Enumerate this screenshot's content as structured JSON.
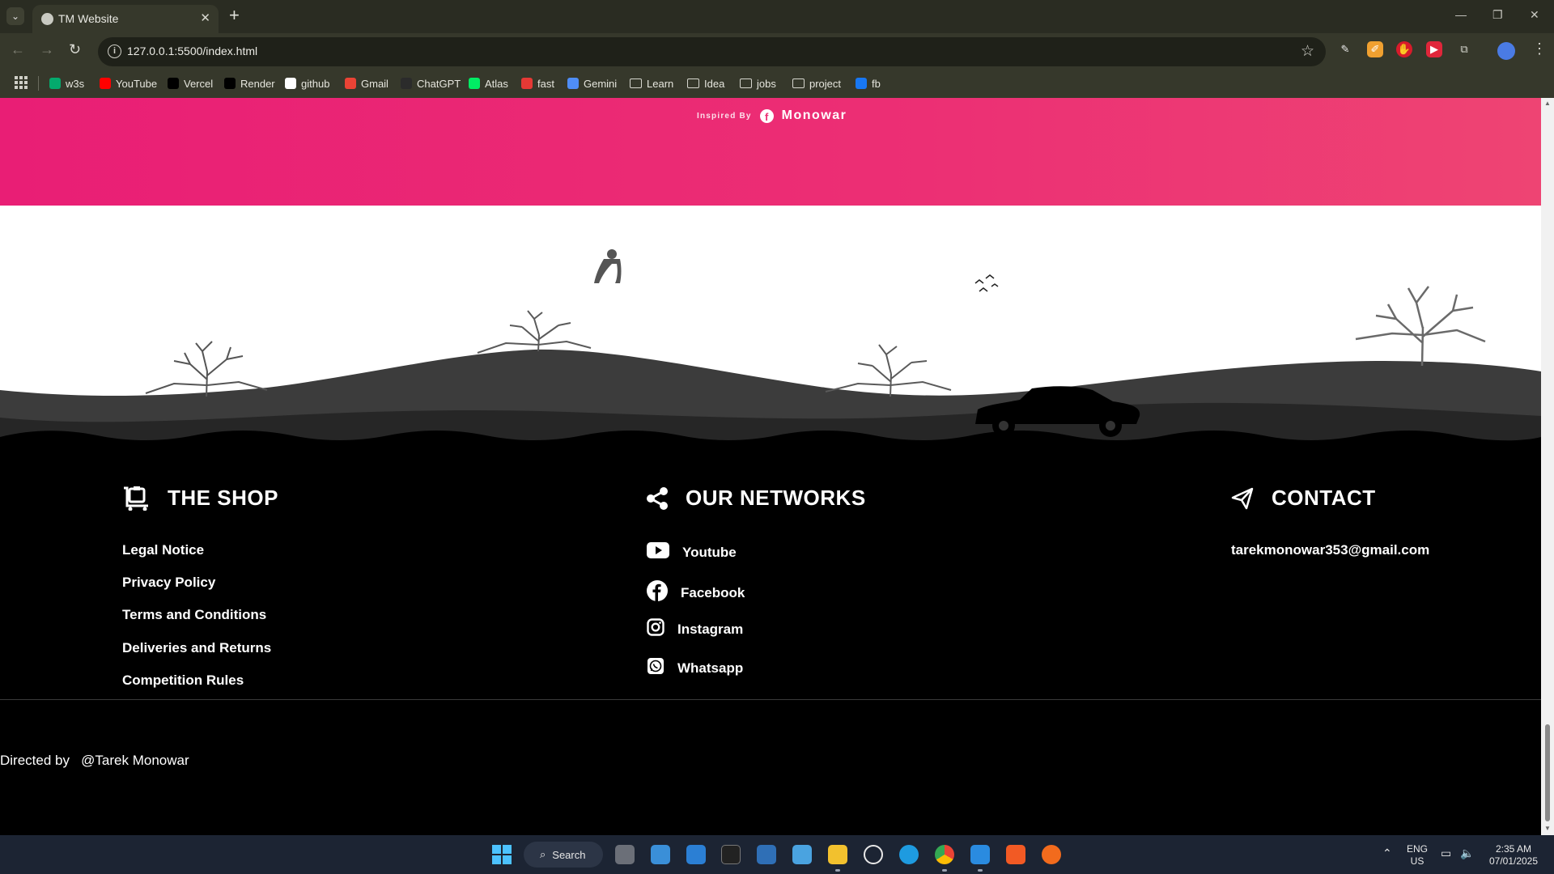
{
  "browser": {
    "tab": {
      "title": "TM Website"
    },
    "url": "127.0.0.1:5500/index.html",
    "bookmarks": [
      {
        "label": "w3s",
        "icon": "w3s-icon",
        "color": "#04aa6d"
      },
      {
        "label": "YouTube",
        "icon": "youtube-icon",
        "color": "#ff0000"
      },
      {
        "label": "Vercel",
        "icon": "vercel-icon",
        "color": "#000000"
      },
      {
        "label": "Render",
        "icon": "render-icon",
        "color": "#000000"
      },
      {
        "label": "github",
        "icon": "github-icon",
        "color": "#ffffff"
      },
      {
        "label": "Gmail",
        "icon": "gmail-icon",
        "color": "#ea4335"
      },
      {
        "label": "ChatGPT",
        "icon": "chatgpt-icon",
        "color": "#2b2b2b"
      },
      {
        "label": "Atlas",
        "icon": "atlas-icon",
        "color": "#00ed64"
      },
      {
        "label": "fast",
        "icon": "fast-icon",
        "color": "#e53935"
      },
      {
        "label": "Gemini",
        "icon": "gemini-icon",
        "color": "#4f8df6"
      },
      {
        "label": "Learn",
        "icon": "folder-icon",
        "color": ""
      },
      {
        "label": "Idea",
        "icon": "folder-icon",
        "color": ""
      },
      {
        "label": "jobs",
        "icon": "folder-icon",
        "color": ""
      },
      {
        "label": "project",
        "icon": "folder-icon",
        "color": ""
      },
      {
        "label": "fb",
        "icon": "facebook-icon",
        "color": "#1877f2"
      }
    ]
  },
  "page": {
    "inspired": {
      "label": "Inspired By",
      "name": "Monowar"
    },
    "shop": {
      "title": "THE SHOP",
      "links": [
        "Legal Notice",
        "Privacy Policy",
        "Terms and Conditions",
        "Deliveries and Returns",
        "Competition Rules"
      ]
    },
    "networks": {
      "title": "OUR NETWORKS",
      "items": [
        {
          "label": "Youtube",
          "icon": "youtube-icon"
        },
        {
          "label": "Facebook",
          "icon": "facebook-icon"
        },
        {
          "label": "Instagram",
          "icon": "instagram-icon"
        },
        {
          "label": "Whatsapp",
          "icon": "whatsapp-icon"
        }
      ]
    },
    "contact": {
      "title": "CONTACT",
      "email": "tarekmonowar353@gmail.com"
    },
    "credit": {
      "prefix": "Directed by",
      "author": "@Tarek Monowar"
    },
    "colors": {
      "pink_band": "#ec2f74",
      "footer_bg": "#000000",
      "hill_dark": "#2a2a2a",
      "hill_light": "#404040"
    }
  },
  "taskbar": {
    "search_label": "Search",
    "language": "ENG",
    "region": "US",
    "time": "2:35 AM",
    "date": "07/01/2025"
  }
}
